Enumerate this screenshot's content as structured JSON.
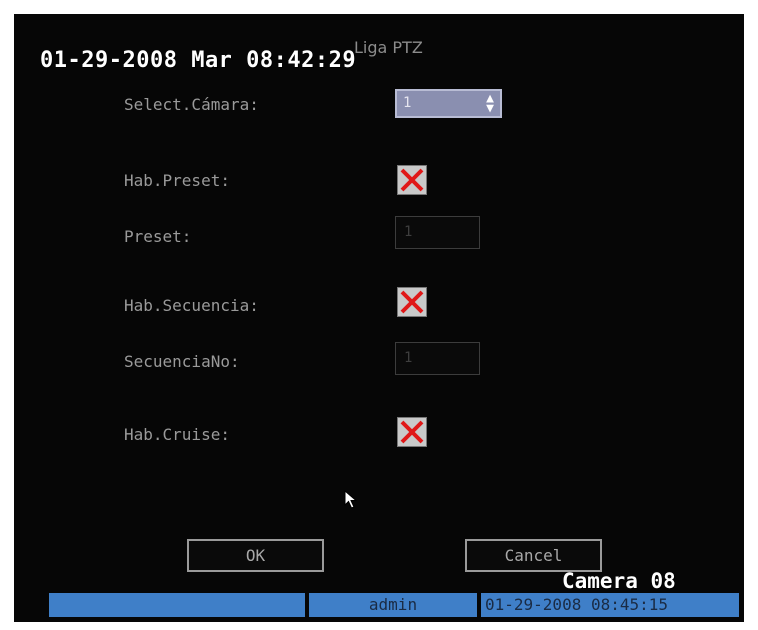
{
  "osd": {
    "datetime": "01-29-2008 Mar 08:42:29"
  },
  "dialog": {
    "title": "Liga PTZ",
    "camera_select": {
      "label": "Select.Cámara:",
      "value": "1"
    },
    "preset_enable": {
      "label": "Hab.Preset:",
      "checked": true
    },
    "preset": {
      "label": "Preset:",
      "value": "1"
    },
    "sequence_enable": {
      "label": "Hab.Secuencia:",
      "checked": true
    },
    "sequence_no": {
      "label": "SecuenciaNo:",
      "value": "1"
    },
    "cruise_enable": {
      "label": "Hab.Cruise:",
      "checked": true
    },
    "ok_label": "OK",
    "cancel_label": "Cancel"
  },
  "camera_name": "Camera 08",
  "status_bar": {
    "user": "admin",
    "datetime": "01-29-2008 08:45:15"
  },
  "icons": {
    "checkbox": "red-x-icon",
    "cursor": "mouse-pointer-icon",
    "spinner": "up-down-arrows-icon"
  },
  "colors": {
    "status_bar": "#3f7fc8",
    "check_mark": "#e01818",
    "select_bg": "#8a8fb0"
  }
}
